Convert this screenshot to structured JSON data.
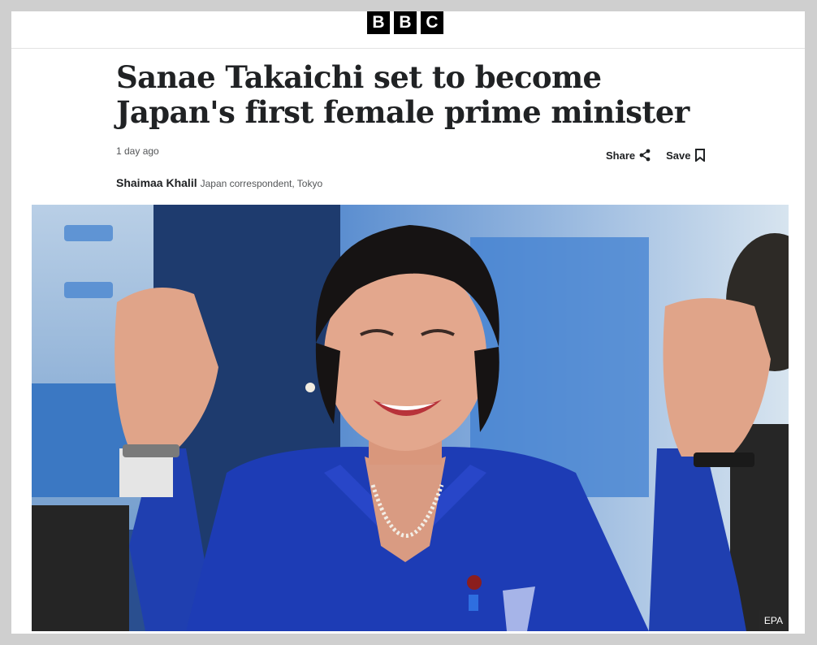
{
  "brand": {
    "letters": [
      "B",
      "B",
      "C"
    ]
  },
  "article": {
    "headline": "Sanae Takaichi set to become Japan's first female prime minister",
    "timestamp": "1 day ago",
    "share_label": "Share",
    "save_label": "Save",
    "author": "Shaimaa Khalil",
    "author_role": "Japan correspondent, Tokyo"
  },
  "image": {
    "credit": "EPA"
  },
  "icons": {
    "share": "share-icon",
    "save": "bookmark-icon"
  }
}
